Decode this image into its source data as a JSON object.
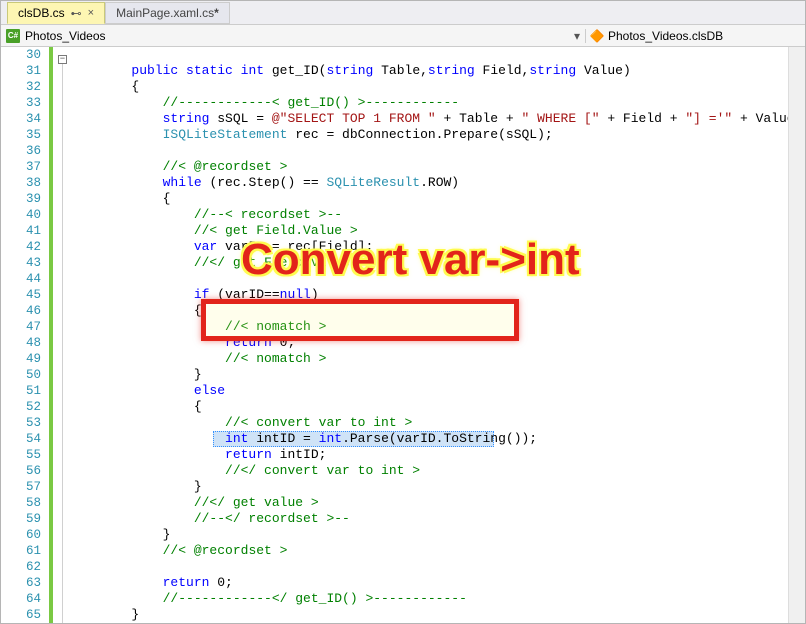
{
  "tabs": [
    {
      "label": "clsDB.cs",
      "pinned": true,
      "active": true,
      "dirty": false
    },
    {
      "label": "MainPage.xaml.cs",
      "pinned": false,
      "active": false,
      "dirty": true
    }
  ],
  "navbar": {
    "left_icon": "csharp-file-icon",
    "left_text": "Photos_Videos",
    "right_icon": "class-icon",
    "right_text": "Photos_Videos.clsDB"
  },
  "line_start": 30,
  "line_end": 65,
  "annotation": {
    "title": "Convert var->int"
  },
  "code_tokens": [
    [],
    [
      [
        "ws",
        "        "
      ],
      [
        "kw",
        "public"
      ],
      [
        "pl",
        " "
      ],
      [
        "kw",
        "static"
      ],
      [
        "pl",
        " "
      ],
      [
        "kw",
        "int"
      ],
      [
        "pl",
        " get_ID("
      ],
      [
        "kw",
        "string"
      ],
      [
        "pl",
        " Table,"
      ],
      [
        "kw",
        "string"
      ],
      [
        "pl",
        " Field,"
      ],
      [
        "kw",
        "string"
      ],
      [
        "pl",
        " Value)"
      ]
    ],
    [
      [
        "ws",
        "        "
      ],
      [
        "pl",
        "{"
      ]
    ],
    [
      [
        "ws",
        "            "
      ],
      [
        "cm",
        "//------------< get_ID() >------------"
      ]
    ],
    [
      [
        "ws",
        "            "
      ],
      [
        "kw",
        "string"
      ],
      [
        "pl",
        " sSQL = "
      ],
      [
        "st",
        "@\"SELECT TOP 1 FROM \""
      ],
      [
        "pl",
        " + Table + "
      ],
      [
        "st",
        "\" WHERE [\""
      ],
      [
        "pl",
        " + Field + "
      ],
      [
        "st",
        "\"] ='\""
      ],
      [
        "pl",
        " + Value + "
      ],
      [
        "st",
        "\"'\""
      ],
      [
        "pl",
        ";"
      ]
    ],
    [
      [
        "ws",
        "            "
      ],
      [
        "ty",
        "ISQLiteStatement"
      ],
      [
        "pl",
        " rec = dbConnection.Prepare(sSQL);"
      ]
    ],
    [],
    [
      [
        "ws",
        "            "
      ],
      [
        "cm",
        "//< @recordset >"
      ]
    ],
    [
      [
        "ws",
        "            "
      ],
      [
        "kw",
        "while"
      ],
      [
        "pl",
        " (rec.Step() == "
      ],
      [
        "ty",
        "SQLiteResult"
      ],
      [
        "pl",
        ".ROW)"
      ]
    ],
    [
      [
        "ws",
        "            "
      ],
      [
        "pl",
        "{"
      ]
    ],
    [
      [
        "ws",
        "                "
      ],
      [
        "cm",
        "//--< recordset >--"
      ]
    ],
    [
      [
        "ws",
        "                "
      ],
      [
        "cm",
        "//< get Field.Value >"
      ]
    ],
    [
      [
        "ws",
        "                "
      ],
      [
        "kw",
        "var"
      ],
      [
        "pl",
        " varID = rec[Field];"
      ]
    ],
    [
      [
        "ws",
        "                "
      ],
      [
        "cm",
        "//</ get Field.Value >"
      ]
    ],
    [],
    [
      [
        "ws",
        "                "
      ],
      [
        "kw",
        "if"
      ],
      [
        "pl",
        " (varID=="
      ],
      [
        "kw",
        "null"
      ],
      [
        "pl",
        ")"
      ]
    ],
    [
      [
        "ws",
        "                "
      ],
      [
        "pl",
        "{"
      ]
    ],
    [
      [
        "ws",
        "                    "
      ],
      [
        "cm",
        "//< nomatch >"
      ]
    ],
    [
      [
        "ws",
        "                    "
      ],
      [
        "kw",
        "return"
      ],
      [
        "pl",
        " 0;"
      ]
    ],
    [
      [
        "ws",
        "                    "
      ],
      [
        "cm",
        "//< nomatch >"
      ]
    ],
    [
      [
        "ws",
        "                "
      ],
      [
        "pl",
        "}"
      ]
    ],
    [
      [
        "ws",
        "                "
      ],
      [
        "kw",
        "else"
      ]
    ],
    [
      [
        "ws",
        "                "
      ],
      [
        "pl",
        "{"
      ]
    ],
    [
      [
        "ws",
        "                    "
      ],
      [
        "cm",
        "//< convert var to int >"
      ]
    ],
    [
      [
        "ws",
        "                    "
      ],
      [
        "kw",
        "int"
      ],
      [
        "pl",
        " intID = "
      ],
      [
        "kw",
        "int"
      ],
      [
        "pl",
        ".Parse(varID.ToString());"
      ]
    ],
    [
      [
        "ws",
        "                    "
      ],
      [
        "kw",
        "return"
      ],
      [
        "pl",
        " intID;"
      ]
    ],
    [
      [
        "ws",
        "                    "
      ],
      [
        "cm",
        "//</ convert var to int >"
      ]
    ],
    [
      [
        "ws",
        "                "
      ],
      [
        "pl",
        "}"
      ]
    ],
    [
      [
        "ws",
        "                "
      ],
      [
        "cm",
        "//</ get value >"
      ]
    ],
    [
      [
        "ws",
        "                "
      ],
      [
        "cm",
        "//--</ recordset >--"
      ]
    ],
    [
      [
        "ws",
        "            "
      ],
      [
        "pl",
        "}"
      ]
    ],
    [
      [
        "ws",
        "            "
      ],
      [
        "cm",
        "//< @recordset >"
      ]
    ],
    [],
    [
      [
        "ws",
        "            "
      ],
      [
        "kw",
        "return"
      ],
      [
        "pl",
        " 0;"
      ]
    ],
    [
      [
        "ws",
        "            "
      ],
      [
        "cm",
        "//------------</ get_ID() >------------"
      ]
    ],
    [
      [
        "ws",
        "        "
      ],
      [
        "pl",
        "}"
      ]
    ]
  ],
  "highlight_line_index": 24,
  "highlight_width_chars": 39
}
